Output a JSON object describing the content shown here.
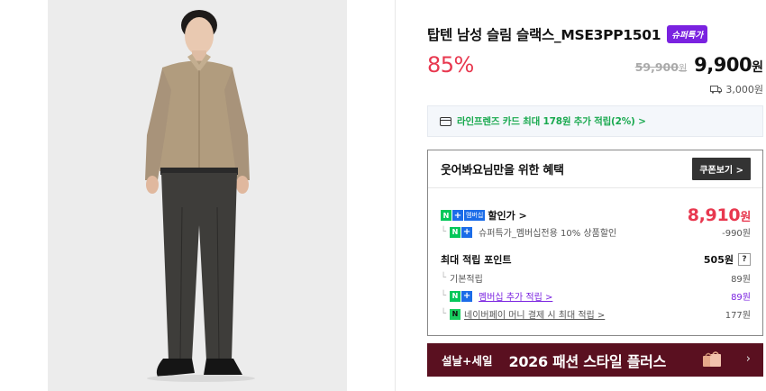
{
  "product": {
    "title": "탑텐 남성 슬림 슬랙스_MSE3PP1501",
    "super_badge": "슈퍼특가",
    "discount": "85%",
    "original_price": "59,900",
    "original_unit": "원",
    "sale_price": "9,900",
    "sale_unit": "원",
    "shipping": "3,000원"
  },
  "card_banner": {
    "text": "라인프렌즈 카드 최대 178원 추가 적립(2%) >"
  },
  "benefits": {
    "title": "웃어봐요님만을 위한 혜택",
    "coupon_button": "쿠폰보기 >",
    "membership": {
      "badge_n": "N",
      "badge_plus": "+",
      "badge_mem": "멤버십",
      "label": "할인가 >",
      "price": "8,910",
      "unit": "원",
      "sub_label": "슈퍼특가_멤버십전용 10% 상품할인",
      "sub_value": "-990원"
    },
    "points": {
      "title": "최대 적립 포인트",
      "total": "505원",
      "help": "?",
      "basic_label": "기본적립",
      "basic_value": "89원",
      "member_label": "멤버십 추가 적립 >",
      "member_value": "89원",
      "pay_label": "네이버페이 머니 결제 시 최대 적립 >",
      "pay_value": "177원",
      "branch": "└"
    }
  },
  "promo": {
    "left": "설날+세일",
    "right": "2026 패션 스타일 플러스",
    "chevron": "›"
  },
  "colors": {
    "accent_red": "#e8384f",
    "naver_green": "#03c75a",
    "purple": "#7a22e0",
    "promo_bg": "#5a1020"
  }
}
